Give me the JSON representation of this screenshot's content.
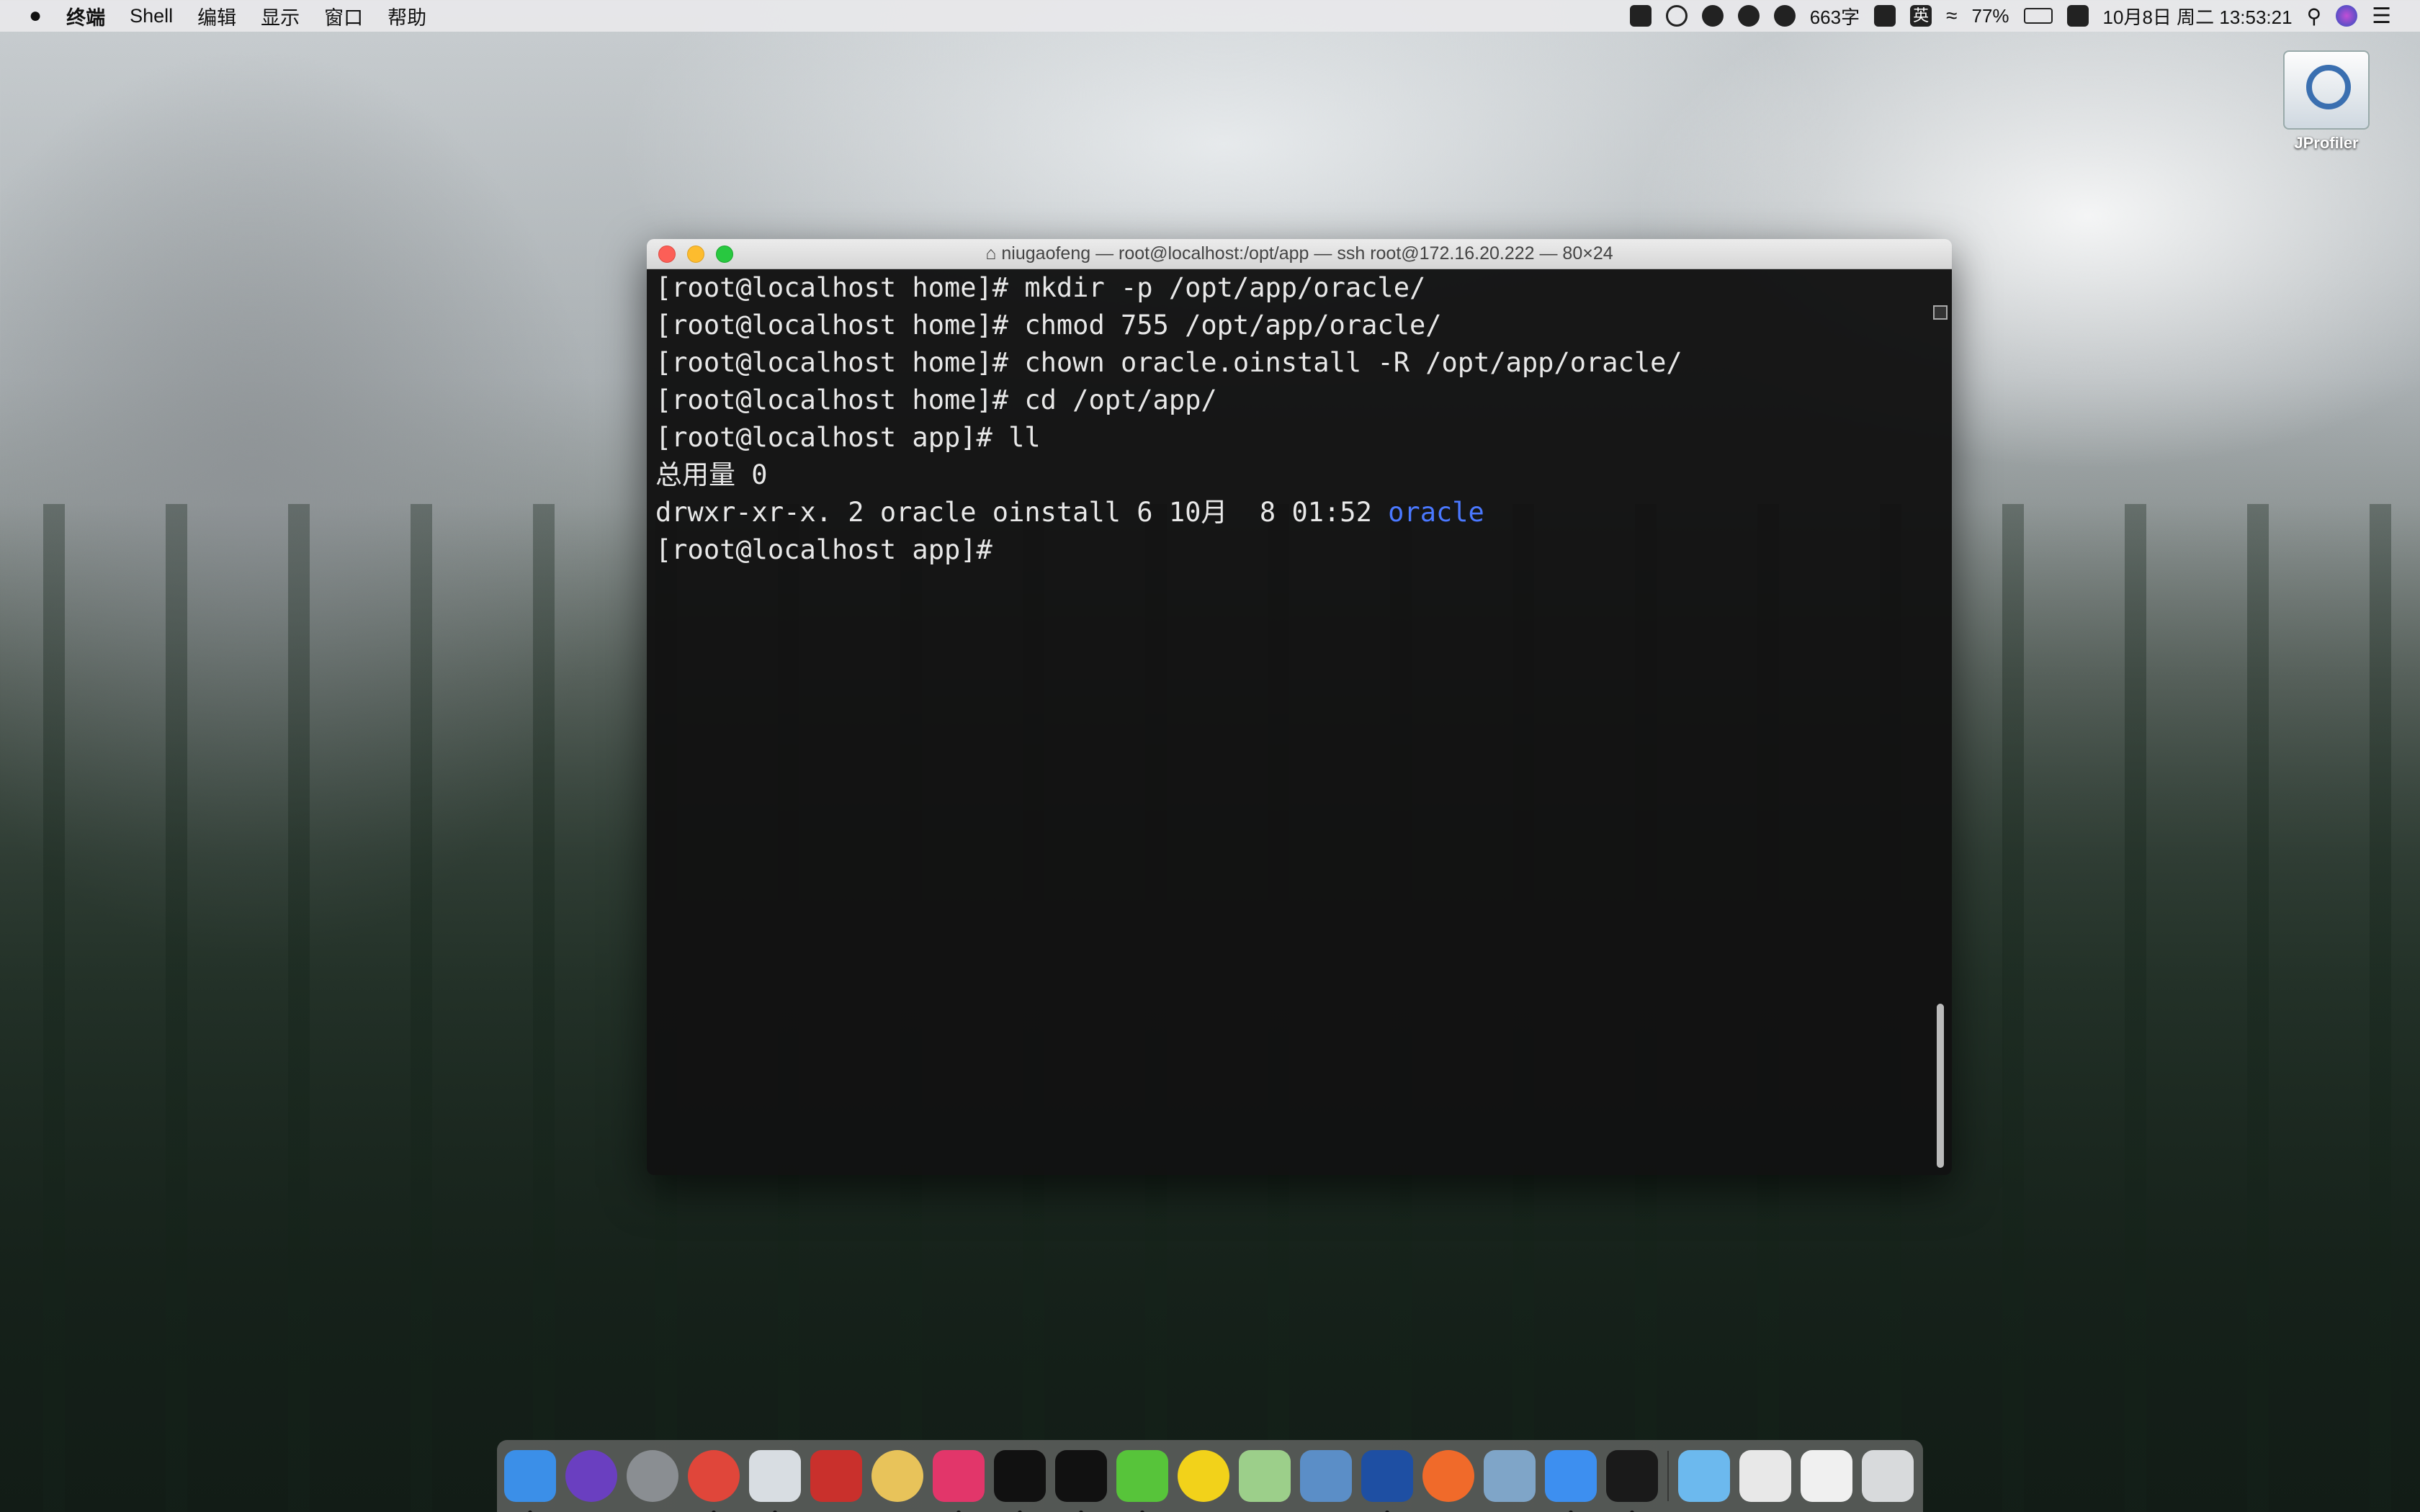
{
  "menubar": {
    "apple": "",
    "app": "终端",
    "items": [
      "Shell",
      "编辑",
      "显示",
      "窗口",
      "帮助"
    ],
    "status": {
      "word_count": "663字",
      "ime": "英",
      "battery": "77%",
      "datetime": "10月8日 周二 13:53:21"
    }
  },
  "desktop": {
    "icon_label": "JProfiler"
  },
  "terminal": {
    "title": "niugaofeng — root@localhost:/opt/app — ssh root@172.16.20.222 — 80×24",
    "lines": [
      "[root@localhost home]# mkdir -p /opt/app/oracle/",
      "[root@localhost home]# chmod 755 /opt/app/oracle/",
      "[root@localhost home]# chown oracle.oinstall -R /opt/app/oracle/",
      "[root@localhost home]# cd /opt/app/",
      "[root@localhost app]# ll",
      "总用量 0"
    ],
    "ls_prefix": "drwxr-xr-x. 2 oracle oinstall 6 10月  8 01:52 ",
    "ls_name": "oracle",
    "prompt": "[root@localhost app]#"
  },
  "dock": [
    {
      "name": "finder",
      "color": "#3b8fe8",
      "running": true
    },
    {
      "name": "siri",
      "color": "#6a3fc0",
      "running": false
    },
    {
      "name": "launchpad",
      "color": "#8a8e92",
      "running": false
    },
    {
      "name": "chrome",
      "color": "#e0463a",
      "running": true
    },
    {
      "name": "preview-utility",
      "color": "#d8dde2",
      "running": true
    },
    {
      "name": "redis",
      "color": "#c9302c",
      "running": false
    },
    {
      "name": "sequel",
      "color": "#e8c35a",
      "running": false
    },
    {
      "name": "intellij",
      "color": "#e2366a",
      "running": true
    },
    {
      "name": "qq",
      "color": "#111111",
      "running": true
    },
    {
      "name": "qq-2",
      "color": "#111111",
      "running": true
    },
    {
      "name": "wechat",
      "color": "#57c43a",
      "running": true
    },
    {
      "name": "qq-music",
      "color": "#f2d21a",
      "running": false
    },
    {
      "name": "maps",
      "color": "#9ccf8a",
      "running": false
    },
    {
      "name": "mail-stamp",
      "color": "#5b8ec7",
      "running": false
    },
    {
      "name": "chat-app",
      "color": "#1e4fa3",
      "running": true
    },
    {
      "name": "postman",
      "color": "#f06a2a",
      "running": false
    },
    {
      "name": "remote-desktop",
      "color": "#7fa5c8",
      "running": false
    },
    {
      "name": "notes-app",
      "color": "#3d8ff0",
      "running": true
    },
    {
      "name": "terminal",
      "color": "#1a1a1a",
      "running": true
    }
  ],
  "dock_right": [
    {
      "name": "downloads-folder",
      "color": "#6cb9ee"
    },
    {
      "name": "window-stack-1",
      "color": "#e8e8e8"
    },
    {
      "name": "window-stack-2",
      "color": "#f0f0f0"
    },
    {
      "name": "trash",
      "color": "#d8dadc"
    }
  ]
}
